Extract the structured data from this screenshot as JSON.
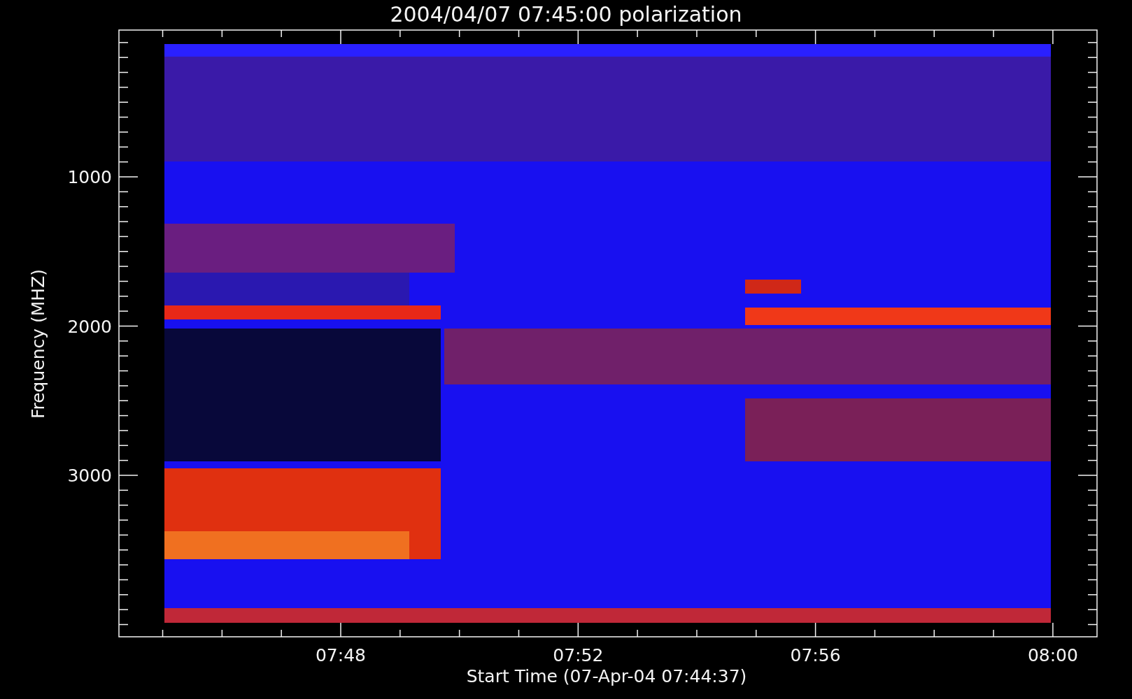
{
  "title": "2004/04/07 07:45:00 polarization",
  "y_axis": {
    "label": "Frequency (MHZ)",
    "ticks": [
      "1000",
      "2000",
      "3000"
    ]
  },
  "x_axis": {
    "label": "Start Time (07-Apr-04 07:44:37)",
    "ticks": [
      "07:48",
      "07:52",
      "07:56",
      "08:00"
    ]
  }
}
